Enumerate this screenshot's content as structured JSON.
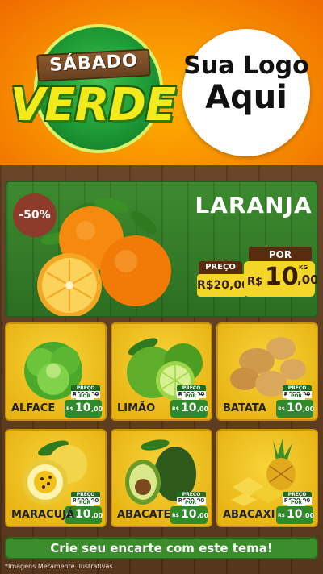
{
  "header": {
    "badge_top": "SÁBADO",
    "badge_main": "VERDE",
    "logo_placeholder_line1": "Sua Logo",
    "logo_placeholder_line2": "Aqui"
  },
  "hero": {
    "discount": "-50%",
    "name": "LARANJA",
    "por_label": "POR",
    "preco_label": "PREÇO",
    "old_price": "R$20,00",
    "currency": "R$",
    "price_int": "10",
    "price_cents": ",00",
    "unit": "KG"
  },
  "products": [
    {
      "name": "ALFACE",
      "preco_label": "PREÇO",
      "old_price": "R$20,00",
      "por_label": "POR",
      "currency": "R$",
      "price_int": "10",
      "price_cents": ",00"
    },
    {
      "name": "LIMÃO",
      "preco_label": "PREÇO",
      "old_price": "R$20,00",
      "por_label": "POR",
      "currency": "R$",
      "price_int": "10",
      "price_cents": ",00"
    },
    {
      "name": "BATATA",
      "preco_label": "PREÇO",
      "old_price": "R$20,00",
      "por_label": "POR",
      "currency": "R$",
      "price_int": "10",
      "price_cents": ",00"
    },
    {
      "name": "MARACUJÁ",
      "preco_label": "PREÇO",
      "old_price": "R$20,00",
      "por_label": "POR",
      "currency": "R$",
      "price_int": "10",
      "price_cents": ",00"
    },
    {
      "name": "ABACATE",
      "preco_label": "PREÇO",
      "old_price": "R$20,00",
      "por_label": "POR",
      "currency": "R$",
      "price_int": "10",
      "price_cents": ",00"
    },
    {
      "name": "ABACAXI",
      "preco_label": "PREÇO",
      "old_price": "R$20,00",
      "por_label": "POR",
      "currency": "R$",
      "price_int": "10",
      "price_cents": ",00"
    }
  ],
  "cta": "Crie seu encarte com este tema!",
  "disclaimer": "*Imagens Meramente Ilustrativas",
  "colors": {
    "header_orange": "#f78f00",
    "green": "#3a8d2a",
    "yellow": "#f4d629",
    "wood": "#6b4528"
  }
}
